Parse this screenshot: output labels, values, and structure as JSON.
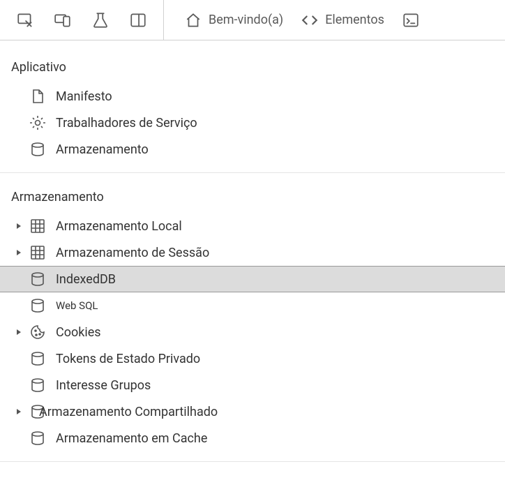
{
  "toolbar": {
    "tabs": {
      "welcome": "Bem-vindo(a)",
      "elements": "Elementos"
    }
  },
  "sections": {
    "application": {
      "title": "Aplicativo",
      "items": {
        "manifest": "Manifesto",
        "service_workers": "Trabalhadores de Serviço",
        "storage": "Armazenamento"
      }
    },
    "storage": {
      "title": "Armazenamento",
      "items": {
        "local_storage": "Armazenamento Local",
        "session_storage": "Armazenamento de Sessão",
        "indexeddb": "IndexedDB",
        "websql": "Web SQL",
        "cookies": "Cookies",
        "private_state_tokens": "Tokens de Estado Privado",
        "interest_groups": "Interesse Grupos",
        "shared_storage": "Armazenamento Compartilhado",
        "cache_storage": "Armazenamento em Cache"
      }
    }
  }
}
